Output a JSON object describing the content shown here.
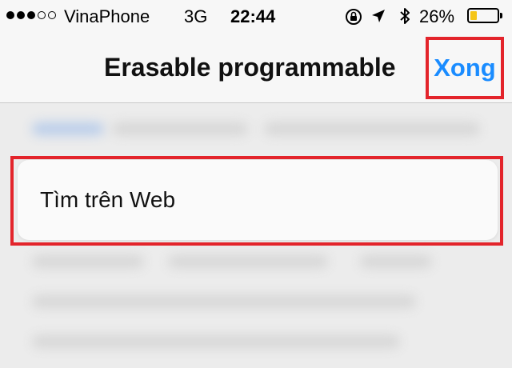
{
  "status_bar": {
    "signal_dots": [
      "full",
      "full",
      "full",
      "empty",
      "empty"
    ],
    "carrier": "VinaPhone",
    "network": "3G",
    "time": "22:44",
    "icons": [
      "orientation-lock-icon",
      "location-arrow-icon",
      "bluetooth-icon"
    ],
    "battery_percent": "26%",
    "battery_level": 0.26,
    "battery_color": "#f5c518"
  },
  "nav_bar": {
    "title": "Erasable programmable",
    "done_label": "Xong",
    "done_color": "#1a8cff"
  },
  "popup": {
    "search_web_label": "Tìm trên Web"
  },
  "annotation_color": "#e3242b"
}
